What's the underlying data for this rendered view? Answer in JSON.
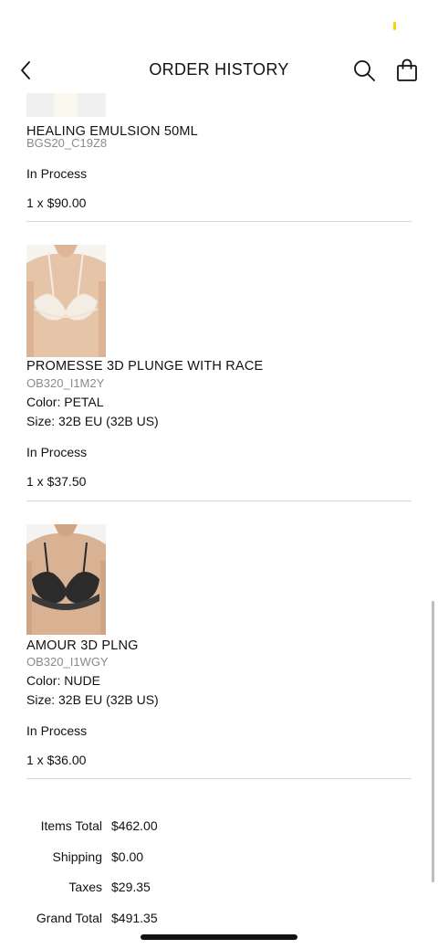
{
  "header": {
    "title": "ORDER HISTORY",
    "back_icon": "chevron-left-icon",
    "search_icon": "search-icon",
    "bag_icon": "shopping-bag-icon"
  },
  "items": [
    {
      "name": "HEALING EMULSION 50ML",
      "sku": "BGS20_C19Z8",
      "status": "In Process",
      "price": "1 x $90.00"
    },
    {
      "name": "PROMESSE 3D PLUNGE WITH RACE",
      "sku": "OB320_I1M2Y",
      "color": "Color: PETAL",
      "size": "Size: 32B EU (32B US)",
      "status": "In Process",
      "price": "1 x $37.50"
    },
    {
      "name": "AMOUR 3D PLNG",
      "sku": "OB320_I1WGY",
      "color": "Color: NUDE",
      "size": "Size: 32B EU (32B US)",
      "status": "In Process",
      "price": "1 x $36.00"
    }
  ],
  "totals": {
    "items_total_label": "Items Total",
    "items_total_value": "$462.00",
    "shipping_label": "Shipping",
    "shipping_value": "$0.00",
    "taxes_label": "Taxes",
    "taxes_value": "$29.35",
    "grand_total_label": "Grand Total",
    "grand_total_value": "$491.35"
  },
  "colors": {
    "accent_status_dot": "#f5d400",
    "divider": "#d9d9d9",
    "sku_text": "#8a8a8a"
  }
}
